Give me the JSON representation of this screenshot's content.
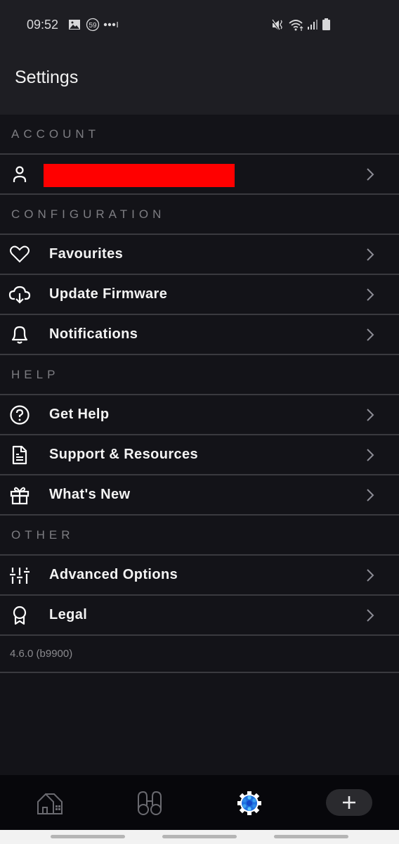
{
  "status_bar": {
    "time": "09:52",
    "notification_badge": "59",
    "left_icons": [
      "gallery-icon",
      "counter-59-icon",
      "more-dots-icon"
    ],
    "right_icons": [
      "mute-vibrate-icon",
      "wifi-icon",
      "signal-icon",
      "battery-icon"
    ]
  },
  "header": {
    "title": "Settings"
  },
  "sections": [
    {
      "title": "ACCOUNT",
      "items": [
        {
          "label": "",
          "icon": "user-icon",
          "redacted": true
        }
      ]
    },
    {
      "title": "CONFIGURATION",
      "items": [
        {
          "label": "Favourites",
          "icon": "heart-icon"
        },
        {
          "label": "Update Firmware",
          "icon": "cloud-download-icon"
        },
        {
          "label": "Notifications",
          "icon": "bell-icon"
        }
      ]
    },
    {
      "title": "HELP",
      "items": [
        {
          "label": "Get Help",
          "icon": "help-circle-icon"
        },
        {
          "label": "Support & Resources",
          "icon": "document-icon"
        },
        {
          "label": "What's New",
          "icon": "gift-icon"
        }
      ]
    },
    {
      "title": "OTHER",
      "items": [
        {
          "label": "Advanced Options",
          "icon": "sliders-icon"
        },
        {
          "label": "Legal",
          "icon": "award-icon"
        }
      ]
    }
  ],
  "version": "4.6.0 (b9900)",
  "bottom_nav": {
    "items": [
      {
        "name": "home",
        "icon": "home-icon",
        "active": false
      },
      {
        "name": "discover",
        "icon": "binoculars-icon",
        "active": false
      },
      {
        "name": "settings",
        "icon": "settings-gear-icon",
        "active": true
      },
      {
        "name": "add",
        "icon": "plus-icon",
        "active": false
      }
    ],
    "active_color": "#1e90ff"
  },
  "colors": {
    "header_bg": "#1e1e23",
    "content_bg": "#131318",
    "separator": "#3a3a3f",
    "section_title": "#7d7d82",
    "redaction": "#ff0000"
  }
}
